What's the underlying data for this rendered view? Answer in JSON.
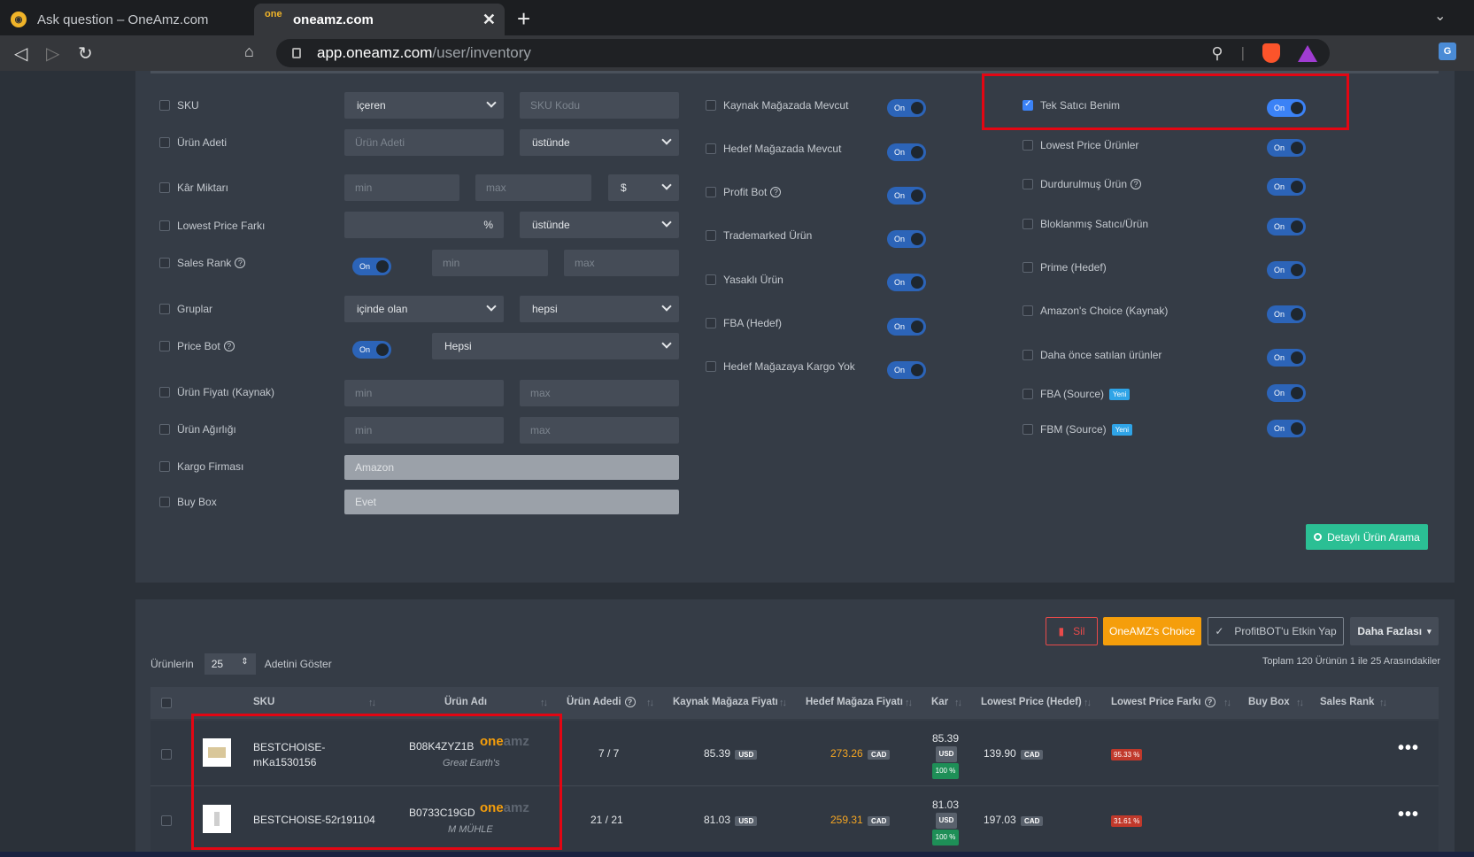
{
  "browser": {
    "tab1_title": "Ask question – OneAmz.com",
    "tab2_title": "oneamz.com",
    "tab2_favicon": "one",
    "url_host": "app.oneamz.com",
    "url_path": "/user/inventory"
  },
  "filters_left": [
    {
      "label": "SKU"
    },
    {
      "label": "Ürün Adeti"
    },
    {
      "label": "Kâr Miktarı"
    },
    {
      "label": "Lowest Price Farkı"
    },
    {
      "label": "Sales Rank"
    },
    {
      "label": "Gruplar"
    },
    {
      "label": "Price Bot"
    },
    {
      "label": "Ürün Fiyatı (Kaynak)"
    },
    {
      "label": "Ürün Ağırlığı"
    },
    {
      "label": "Kargo Firması"
    },
    {
      "label": "Buy Box"
    }
  ],
  "controls": {
    "sku_op": "içeren",
    "sku_ph": "SKU Kodu",
    "qty_ph": "Ürün Adeti",
    "qty_op": "üstünde",
    "profit_min": "min",
    "profit_max": "max",
    "profit_cur": "$",
    "lpf_unit": "%",
    "lpf_op": "üstünde",
    "toggle_on": "On",
    "rank_min": "min",
    "rank_max": "max",
    "group_op": "içinde olan",
    "group_val": "hepsi",
    "pricebot_val": "Hepsi",
    "price_min": "min",
    "price_max": "max",
    "weight_min": "min",
    "weight_max": "max",
    "cargo": "Amazon",
    "buybox": "Evet"
  },
  "filters_mid": [
    "Kaynak Mağazada Mevcut",
    "Hedef Mağazada Mevcut",
    "Profit Bot",
    "Trademarked Ürün",
    "Yasaklı Ürün",
    "FBA (Hedef)",
    "Hedef Mağazaya Kargo Yok"
  ],
  "filters_right": [
    "Tek Satıcı Benim",
    "Lowest Price Ürünler",
    "Durdurulmuş Ürün",
    "Bloklanmış Satıcı/Ürün",
    "Prime (Hedef)",
    "Amazon's Choice (Kaynak)",
    "Daha önce satılan ürünler",
    "FBA (Source)",
    "FBM (Source)"
  ],
  "new_badge": "Yeni",
  "search_button": "Detaylı Ürün Arama",
  "actions": {
    "delete": "Sil",
    "choice": "OneAMZ's Choice",
    "profitbot": "ProfitBOT'u Etkin Yap",
    "more": "Daha Fazlası"
  },
  "paging": {
    "prefix": "Ürünlerin",
    "size": "25",
    "suffix": "Adetini Göster",
    "total": "Toplam 120 Ürünün 1 ile 25 Arasındakiler"
  },
  "table": {
    "headers": [
      "SKU",
      "Ürün Adı",
      "Ürün Adedi",
      "Kaynak Mağaza Fiyatı",
      "Hedef Mağaza Fiyatı",
      "Kar",
      "Lowest Price (Hedef)",
      "Lowest Price Farkı",
      "Buy Box",
      "Sales Rank"
    ],
    "rows": [
      {
        "sku": "BESTCHOISE-mKa1530156",
        "asin": "B08K4ZYZ1B",
        "brand": "Great Earth's",
        "qty": "7 / 7",
        "source_price": "85.39",
        "source_cur": "USD",
        "target_price": "273.26",
        "target_cur": "CAD",
        "profit": "85.39",
        "profit_cur": "USD",
        "profit_pct": "100 %",
        "lowest": "139.90",
        "lowest_cur": "CAD",
        "diff": "95.33 %"
      },
      {
        "sku": "BESTCHOISE-52r191104",
        "asin": "B0733C19GD",
        "brand": "M MÜHLE",
        "qty": "21 / 21",
        "source_price": "81.03",
        "source_cur": "USD",
        "target_price": "259.31",
        "target_cur": "CAD",
        "profit": "81.03",
        "profit_cur": "USD",
        "profit_pct": "100 %",
        "lowest": "197.03",
        "lowest_cur": "CAD",
        "diff": "31.61 %"
      }
    ],
    "logo_one": "one",
    "logo_amz": "amz"
  },
  "colors": {
    "accent": "#3b82f6",
    "highlight_box": "#e30613",
    "search_button": "#2bbf94",
    "choice_button": "#f59e0b"
  }
}
